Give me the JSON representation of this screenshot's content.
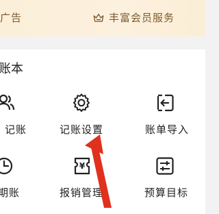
{
  "banner": {
    "ad_label": "广告",
    "service_label": "丰富会员服务"
  },
  "section": {
    "title": "账本",
    "items": [
      {
        "label": "记账",
        "icon": "people-icon"
      },
      {
        "label": "记账设置",
        "icon": "gear-icon"
      },
      {
        "label": "账单导入",
        "icon": "import-icon"
      },
      {
        "label": "期账",
        "icon": "clock-icon"
      },
      {
        "label": "报销管理",
        "icon": "reimburse-icon"
      },
      {
        "label": "预算目标",
        "icon": "budget-sliders-icon"
      }
    ]
  },
  "colors": {
    "banner_bg": "#fbefd9",
    "banner_text": "#7a5a2e",
    "arrow": "#e0301e"
  }
}
